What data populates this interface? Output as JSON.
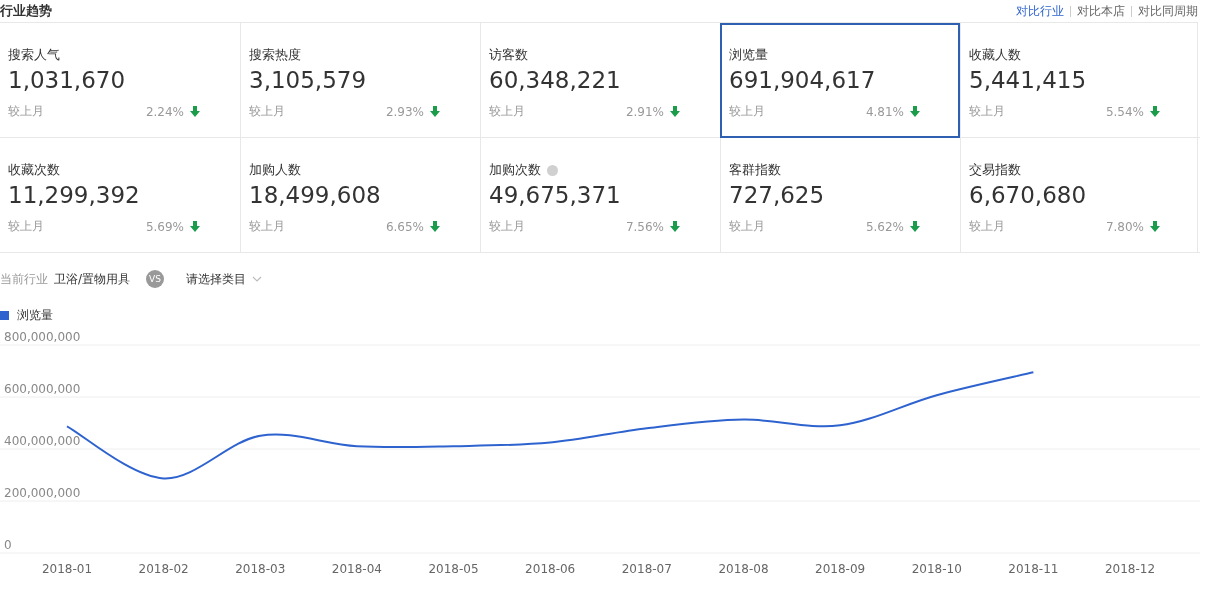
{
  "header": {
    "title": "行业趋势",
    "links": [
      {
        "label": "对比行业",
        "selected": true
      },
      {
        "label": "对比本店",
        "selected": false
      },
      {
        "label": "对比同周期",
        "selected": false
      }
    ]
  },
  "metrics": [
    {
      "label": "搜索人气",
      "value": "1,031,670",
      "compare": "较上月",
      "change": "2.24%",
      "decrease": true,
      "selected": false,
      "help": false
    },
    {
      "label": "搜索热度",
      "value": "3,105,579",
      "compare": "较上月",
      "change": "2.93%",
      "decrease": true,
      "selected": false,
      "help": false
    },
    {
      "label": "访客数",
      "value": "60,348,221",
      "compare": "较上月",
      "change": "2.91%",
      "decrease": true,
      "selected": false,
      "help": false
    },
    {
      "label": "浏览量",
      "value": "691,904,617",
      "compare": "较上月",
      "change": "4.81%",
      "decrease": true,
      "selected": true,
      "help": false
    },
    {
      "label": "收藏人数",
      "value": "5,441,415",
      "compare": "较上月",
      "change": "5.54%",
      "decrease": true,
      "selected": false,
      "help": false
    },
    {
      "label": "收藏次数",
      "value": "11,299,392",
      "compare": "较上月",
      "change": "5.69%",
      "decrease": true,
      "selected": false,
      "help": false
    },
    {
      "label": "加购人数",
      "value": "18,499,608",
      "compare": "较上月",
      "change": "6.65%",
      "decrease": true,
      "selected": false,
      "help": false
    },
    {
      "label": "加购次数",
      "value": "49,675,371",
      "compare": "较上月",
      "change": "7.56%",
      "decrease": true,
      "selected": false,
      "help": true
    },
    {
      "label": "客群指数",
      "value": "727,625",
      "compare": "较上月",
      "change": "5.62%",
      "decrease": true,
      "selected": false,
      "help": false
    },
    {
      "label": "交易指数",
      "value": "6,670,680",
      "compare": "较上月",
      "change": "7.80%",
      "decrease": true,
      "selected": false,
      "help": false
    }
  ],
  "filter": {
    "label": "当前行业",
    "industry": "卫浴/置物用具",
    "vs": "VS",
    "placeholder": "请选择类目"
  },
  "chart_data": {
    "type": "line",
    "grid": true,
    "categories": [
      "2018-01",
      "2018-02",
      "2018-03",
      "2018-04",
      "2018-05",
      "2018-06",
      "2018-07",
      "2018-08",
      "2018-09",
      "2018-10",
      "2018-11",
      "2018-12"
    ],
    "ylim": [
      0,
      800000000
    ],
    "yticks": [
      {
        "value": 0,
        "label": "0"
      },
      {
        "value": 200000000,
        "label": "200,000,000"
      },
      {
        "value": 400000000,
        "label": "400,000,000"
      },
      {
        "value": 600000000,
        "label": "600,000,000"
      },
      {
        "value": 800000000,
        "label": "800,000,000"
      }
    ],
    "series": [
      {
        "name": "浏览量",
        "color": "#2e63cf",
        "values": [
          487000000,
          287000000,
          451000000,
          411000000,
          411000000,
          425000000,
          480000000,
          513000000,
          491000000,
          607000000,
          695000000,
          null
        ]
      }
    ]
  }
}
